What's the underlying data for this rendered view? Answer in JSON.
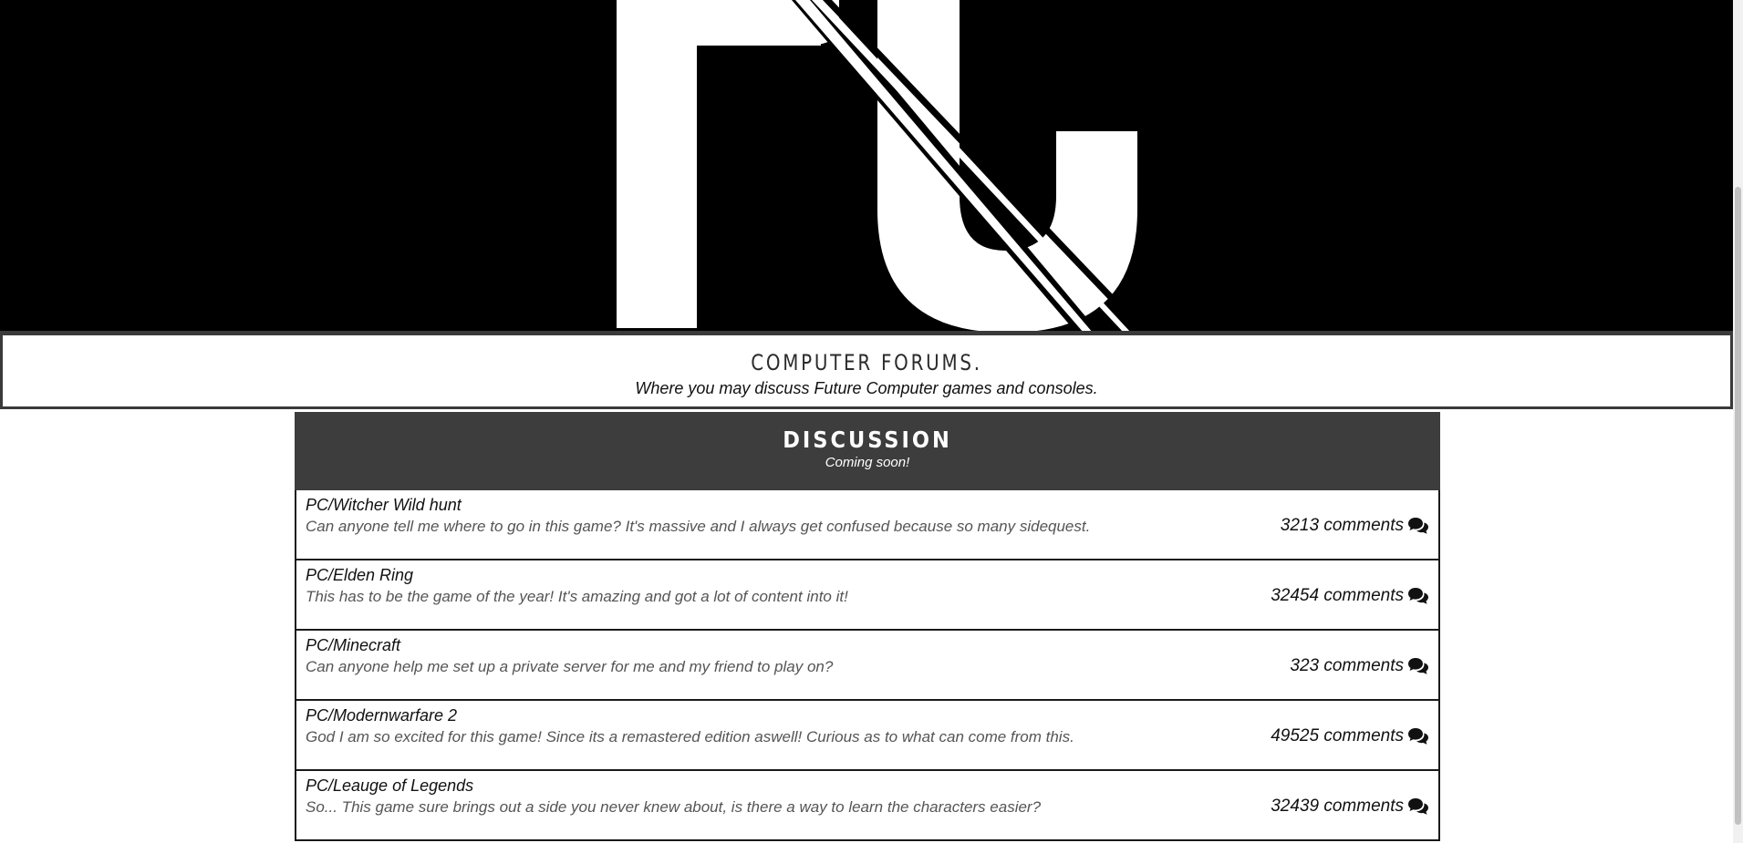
{
  "logo": {
    "letters": "PC"
  },
  "site": {
    "title": "COMPUTER FORUMS.",
    "tagline": "Where you may discuss Future Computer games and consoles."
  },
  "discussion": {
    "heading": "DISCUSSION",
    "subheading": "Coming soon!",
    "threads": [
      {
        "title": "PC/Witcher Wild hunt",
        "body": "Can anyone tell me where to go in this game? It's massive and I always get confused because so many sidequest.",
        "count": "3213",
        "count_label": "comments"
      },
      {
        "title": "PC/Elden Ring",
        "body": "This has to be the game of the year! It's amazing and got a lot of content into it!",
        "count": "32454",
        "count_label": "comments"
      },
      {
        "title": "PC/Minecraft",
        "body": "Can anyone help me set up a private server for me and my friend to play on?",
        "count": "323",
        "count_label": "comments"
      },
      {
        "title": "PC/Modernwarfare 2",
        "body": "God I am so excited for this game! Since its a remastered edition aswell! Curious as to what can come from this.",
        "count": "49525",
        "count_label": "comments"
      },
      {
        "title": "PC/Leauge of Legends",
        "body": "So... This game sure brings out a side you never knew about, is there a way to learn the characters easier?",
        "count": "32439",
        "count_label": "comments"
      }
    ]
  },
  "icons": {
    "comments": "comments-icon"
  },
  "colors": {
    "hero_bg": "#000000",
    "logo_fg": "#ffffff",
    "header_bg": "#3d3d3d",
    "border": "#1a1a1a"
  }
}
